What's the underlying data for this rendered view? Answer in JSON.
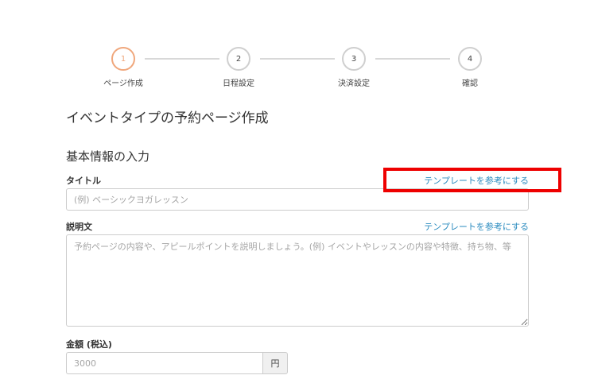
{
  "stepper": {
    "steps": [
      {
        "number": "1",
        "label": "ページ作成",
        "active": true
      },
      {
        "number": "2",
        "label": "日程設定",
        "active": false
      },
      {
        "number": "3",
        "label": "決済設定",
        "active": false
      },
      {
        "number": "4",
        "label": "確認",
        "active": false
      }
    ]
  },
  "page_title": "イベントタイプの予約ページ作成",
  "section_title": "基本情報の入力",
  "title_field": {
    "label": "タイトル",
    "placeholder": "(例) ベーシックヨガレッスン",
    "template_link": "テンプレートを参考にする"
  },
  "description_field": {
    "label": "説明文",
    "placeholder": "予約ページの内容や、アピールポイントを説明しましょう。(例) イベントやレッスンの内容や特徴、持ち物、等",
    "template_link": "テンプレートを参考にする"
  },
  "price_field": {
    "label": "金額 (税込)",
    "placeholder": "3000",
    "unit": "円"
  },
  "colors": {
    "active_step": "#f0a77c",
    "link": "#2a8bbf",
    "highlight": "#ee0000"
  }
}
